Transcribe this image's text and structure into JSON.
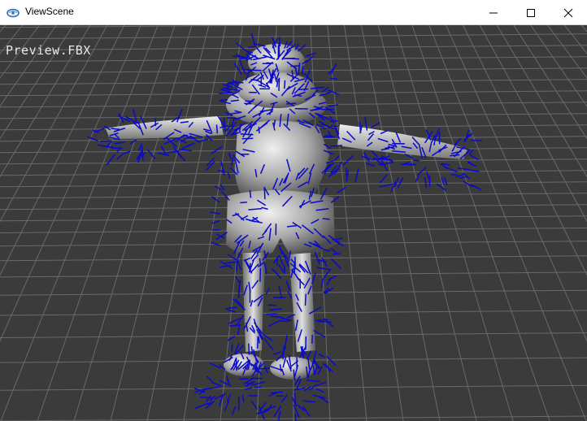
{
  "window": {
    "title": "ViewScene",
    "app_icon": "viewscene-app-icon",
    "controls": {
      "minimize_icon": "minimize-icon",
      "maximize_icon": "maximize-icon",
      "close_icon": "close-icon"
    }
  },
  "viewport": {
    "file_label": "Preview.FBX",
    "background_color": "#3b3b3b",
    "grid_color": "#6a6a6a",
    "model_color": "#c8c8c8",
    "normals_color": "#0a0ac8"
  }
}
